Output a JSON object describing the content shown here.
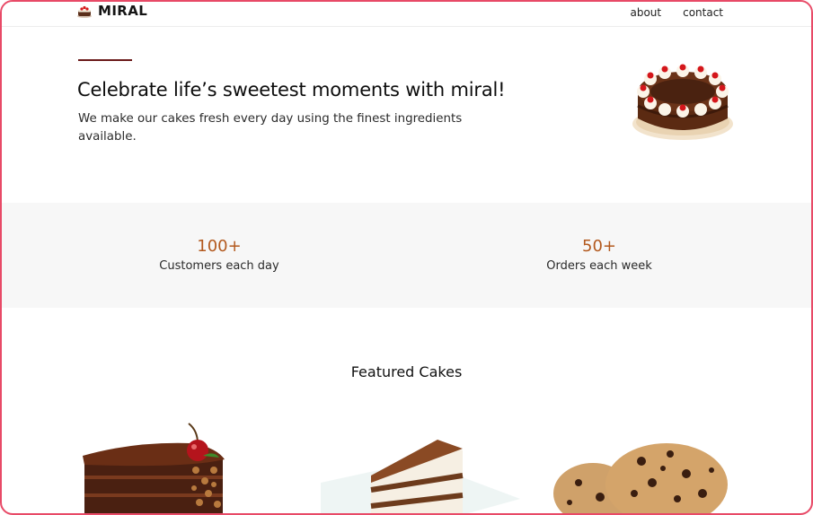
{
  "brand": {
    "name": "MIRAL",
    "icon": "cake-logo-icon"
  },
  "nav": {
    "links": [
      {
        "label": "about"
      },
      {
        "label": "contact"
      }
    ]
  },
  "hero": {
    "title": "Celebrate life’s sweetest moments with miral!",
    "subtitle": "We make our cakes fresh every day using the finest ingredients available.",
    "image": "chocolate-cream-cake-image"
  },
  "stats": [
    {
      "value": "100+",
      "label": "Customers each day"
    },
    {
      "value": "50+",
      "label": "Orders each week"
    }
  ],
  "featured": {
    "title": "Featured Cakes",
    "items": [
      {
        "image": "chocolate-cake-slice-image"
      },
      {
        "image": "tiramisu-slice-image"
      },
      {
        "image": "chocolate-chip-cookies-image"
      }
    ]
  },
  "colors": {
    "accent": "#b3591e",
    "rule": "#6b1a1a",
    "frame_border": "#e84a67",
    "stats_background": "#f7f7f7"
  }
}
